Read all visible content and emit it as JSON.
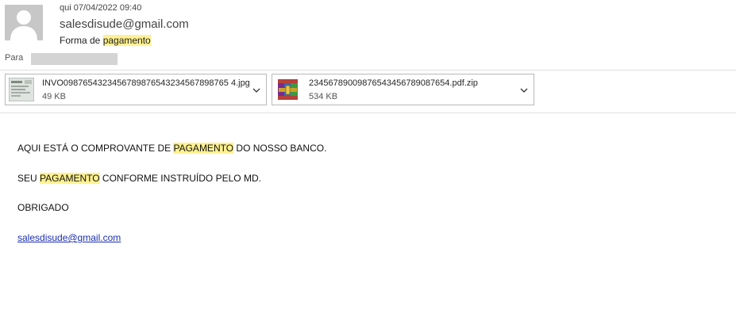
{
  "header": {
    "date": "qui 07/04/2022 09:40",
    "sender": "salesdisude@gmail.com",
    "subject_prefix": "Forma de ",
    "subject_highlight": "pagamento"
  },
  "recipients": {
    "label": "Para"
  },
  "attachments": [
    {
      "name": "INVO0987654323456789876543234567898765 4.jpg",
      "size": "49 KB",
      "icon": "image-thumbnail-icon"
    },
    {
      "name": "23456789009876543456789087654.pdf.zip",
      "size": "534 KB",
      "icon": "winrar-archive-icon"
    }
  ],
  "body": {
    "line1_before": "AQUI ESTÁ O COMPROVANTE DE ",
    "line1_highlight": "PAGAMENTO",
    "line1_after": " DO NOSSO BANCO.",
    "line2_before": "SEU ",
    "line2_highlight": "PAGAMENTO",
    "line2_after": " CONFORME INSTRUÍDO PELO MD.",
    "line3": "OBRIGADO",
    "link": "salesdisude@gmail.com"
  },
  "colors": {
    "highlight": "#fff191",
    "link": "#1a2eb0",
    "avatar": "#c7c7c7"
  }
}
